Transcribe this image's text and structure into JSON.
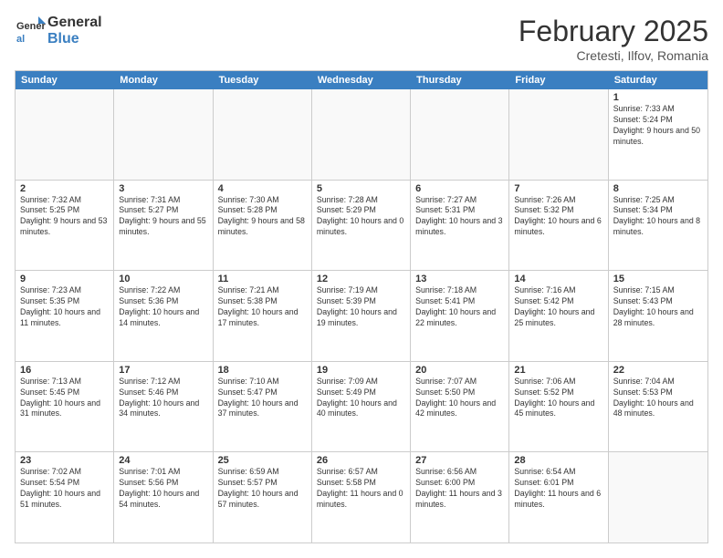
{
  "header": {
    "logo_line1": "General",
    "logo_line2": "Blue",
    "month_year": "February 2025",
    "location": "Cretesti, Ilfov, Romania"
  },
  "weekdays": [
    "Sunday",
    "Monday",
    "Tuesday",
    "Wednesday",
    "Thursday",
    "Friday",
    "Saturday"
  ],
  "weeks": [
    [
      {
        "day": "",
        "info": ""
      },
      {
        "day": "",
        "info": ""
      },
      {
        "day": "",
        "info": ""
      },
      {
        "day": "",
        "info": ""
      },
      {
        "day": "",
        "info": ""
      },
      {
        "day": "",
        "info": ""
      },
      {
        "day": "1",
        "info": "Sunrise: 7:33 AM\nSunset: 5:24 PM\nDaylight: 9 hours and 50 minutes."
      }
    ],
    [
      {
        "day": "2",
        "info": "Sunrise: 7:32 AM\nSunset: 5:25 PM\nDaylight: 9 hours and 53 minutes."
      },
      {
        "day": "3",
        "info": "Sunrise: 7:31 AM\nSunset: 5:27 PM\nDaylight: 9 hours and 55 minutes."
      },
      {
        "day": "4",
        "info": "Sunrise: 7:30 AM\nSunset: 5:28 PM\nDaylight: 9 hours and 58 minutes."
      },
      {
        "day": "5",
        "info": "Sunrise: 7:28 AM\nSunset: 5:29 PM\nDaylight: 10 hours and 0 minutes."
      },
      {
        "day": "6",
        "info": "Sunrise: 7:27 AM\nSunset: 5:31 PM\nDaylight: 10 hours and 3 minutes."
      },
      {
        "day": "7",
        "info": "Sunrise: 7:26 AM\nSunset: 5:32 PM\nDaylight: 10 hours and 6 minutes."
      },
      {
        "day": "8",
        "info": "Sunrise: 7:25 AM\nSunset: 5:34 PM\nDaylight: 10 hours and 8 minutes."
      }
    ],
    [
      {
        "day": "9",
        "info": "Sunrise: 7:23 AM\nSunset: 5:35 PM\nDaylight: 10 hours and 11 minutes."
      },
      {
        "day": "10",
        "info": "Sunrise: 7:22 AM\nSunset: 5:36 PM\nDaylight: 10 hours and 14 minutes."
      },
      {
        "day": "11",
        "info": "Sunrise: 7:21 AM\nSunset: 5:38 PM\nDaylight: 10 hours and 17 minutes."
      },
      {
        "day": "12",
        "info": "Sunrise: 7:19 AM\nSunset: 5:39 PM\nDaylight: 10 hours and 19 minutes."
      },
      {
        "day": "13",
        "info": "Sunrise: 7:18 AM\nSunset: 5:41 PM\nDaylight: 10 hours and 22 minutes."
      },
      {
        "day": "14",
        "info": "Sunrise: 7:16 AM\nSunset: 5:42 PM\nDaylight: 10 hours and 25 minutes."
      },
      {
        "day": "15",
        "info": "Sunrise: 7:15 AM\nSunset: 5:43 PM\nDaylight: 10 hours and 28 minutes."
      }
    ],
    [
      {
        "day": "16",
        "info": "Sunrise: 7:13 AM\nSunset: 5:45 PM\nDaylight: 10 hours and 31 minutes."
      },
      {
        "day": "17",
        "info": "Sunrise: 7:12 AM\nSunset: 5:46 PM\nDaylight: 10 hours and 34 minutes."
      },
      {
        "day": "18",
        "info": "Sunrise: 7:10 AM\nSunset: 5:47 PM\nDaylight: 10 hours and 37 minutes."
      },
      {
        "day": "19",
        "info": "Sunrise: 7:09 AM\nSunset: 5:49 PM\nDaylight: 10 hours and 40 minutes."
      },
      {
        "day": "20",
        "info": "Sunrise: 7:07 AM\nSunset: 5:50 PM\nDaylight: 10 hours and 42 minutes."
      },
      {
        "day": "21",
        "info": "Sunrise: 7:06 AM\nSunset: 5:52 PM\nDaylight: 10 hours and 45 minutes."
      },
      {
        "day": "22",
        "info": "Sunrise: 7:04 AM\nSunset: 5:53 PM\nDaylight: 10 hours and 48 minutes."
      }
    ],
    [
      {
        "day": "23",
        "info": "Sunrise: 7:02 AM\nSunset: 5:54 PM\nDaylight: 10 hours and 51 minutes."
      },
      {
        "day": "24",
        "info": "Sunrise: 7:01 AM\nSunset: 5:56 PM\nDaylight: 10 hours and 54 minutes."
      },
      {
        "day": "25",
        "info": "Sunrise: 6:59 AM\nSunset: 5:57 PM\nDaylight: 10 hours and 57 minutes."
      },
      {
        "day": "26",
        "info": "Sunrise: 6:57 AM\nSunset: 5:58 PM\nDaylight: 11 hours and 0 minutes."
      },
      {
        "day": "27",
        "info": "Sunrise: 6:56 AM\nSunset: 6:00 PM\nDaylight: 11 hours and 3 minutes."
      },
      {
        "day": "28",
        "info": "Sunrise: 6:54 AM\nSunset: 6:01 PM\nDaylight: 11 hours and 6 minutes."
      },
      {
        "day": "",
        "info": ""
      }
    ]
  ]
}
